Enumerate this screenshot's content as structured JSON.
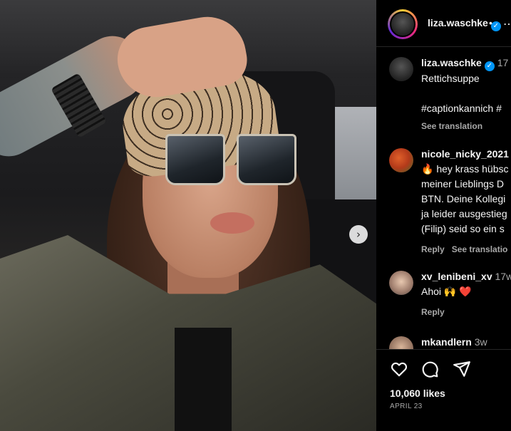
{
  "post": {
    "author": "liza.waschke",
    "header_separator": "•",
    "more_label": "…",
    "next_label": "›",
    "likes": "10,060 likes",
    "date": "APRIL 23"
  },
  "caption": {
    "user": "liza.waschke",
    "time": "17",
    "lines": [
      "Rettichsuppe",
      "",
      "#captionkannich #"
    ],
    "see_translation": "See translation"
  },
  "comments": [
    {
      "user": "nicole_nicky_2021",
      "time": "",
      "lines": [
        "🔥 hey krass hübsc",
        "meiner Lieblings D",
        "BTN. Deine Kollegi",
        "ja leider ausgestieg",
        "(Filip) seid so ein s"
      ],
      "reply": "Reply",
      "see_translation": "See translatio"
    },
    {
      "user": "xv_lenibeni_xv",
      "time": "17w",
      "lines": [
        "Ahoi 🙌 ❤️"
      ],
      "reply": "Reply"
    },
    {
      "user": "mkandlern",
      "time": "3w",
      "lines": []
    }
  ],
  "colors": {
    "background": "#000000",
    "text": "#f5f5f5",
    "muted": "#a8a8a8",
    "verified": "#0095f6",
    "like_heart": "#ed4956"
  },
  "icons": [
    "heart-icon",
    "comment-icon",
    "share-icon",
    "verified-icon",
    "more-icon",
    "chevron-right-icon"
  ]
}
